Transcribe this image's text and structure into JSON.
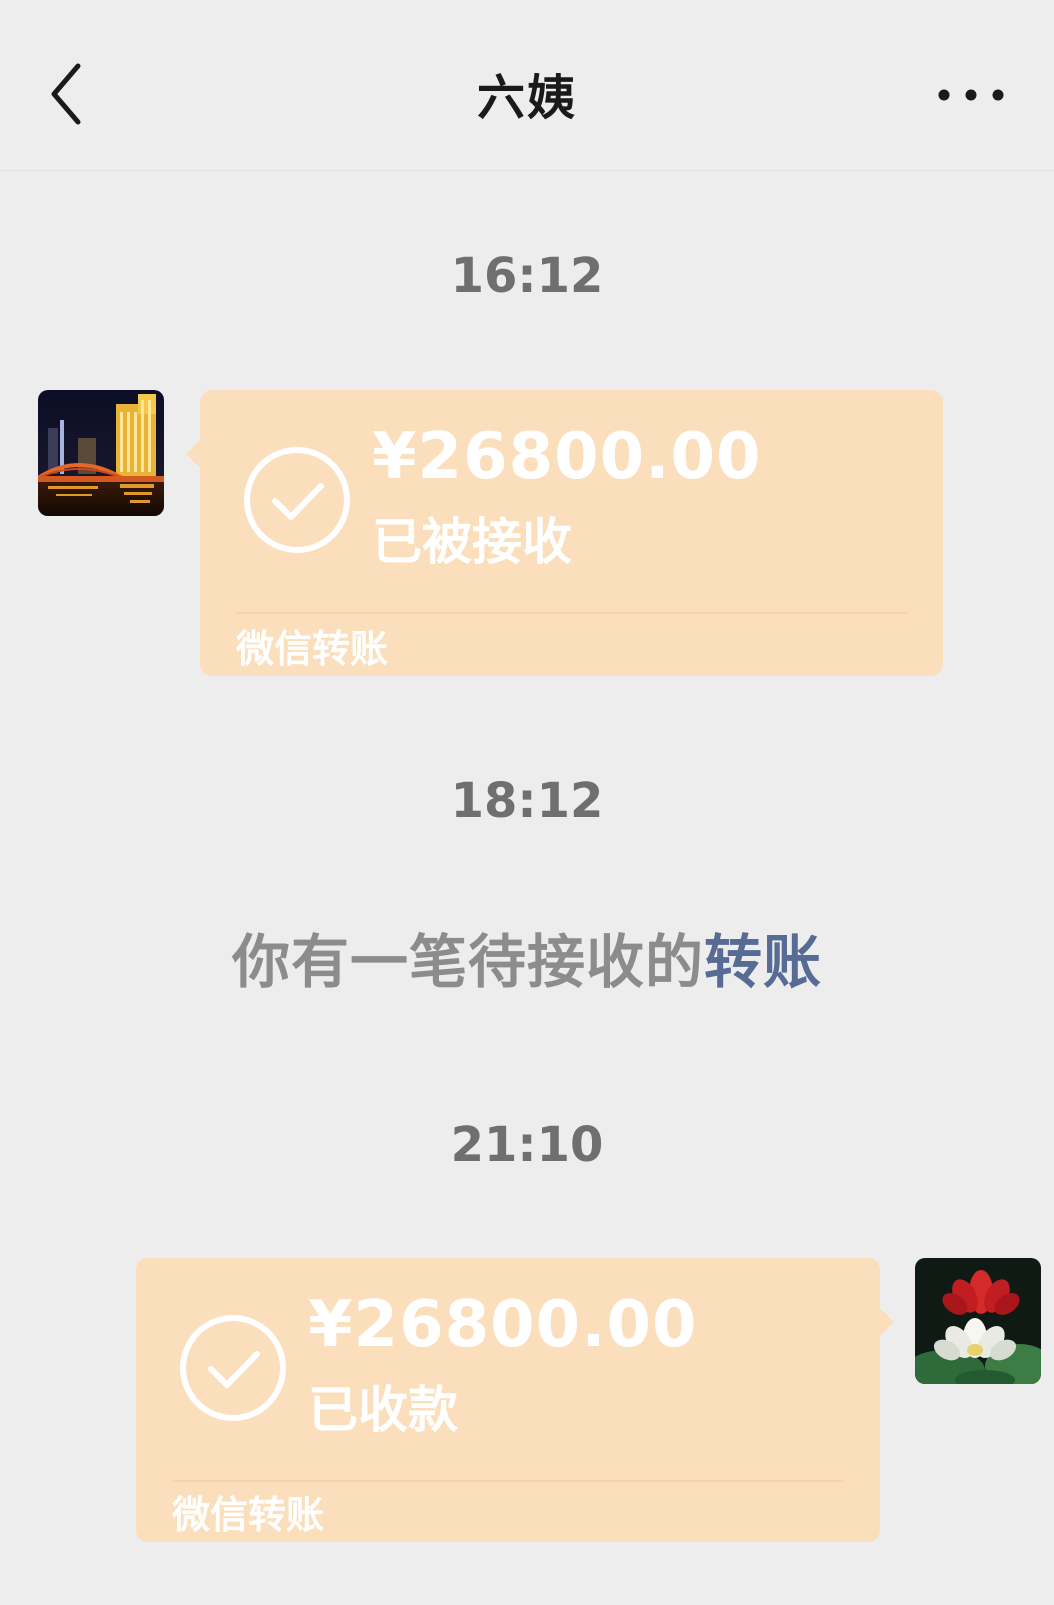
{
  "header": {
    "title": "六姨",
    "back_icon": "chevron-left-icon",
    "more_icon": "more-dots-icon"
  },
  "messages": [
    {
      "timestamp": "16:12",
      "transfer": {
        "direction": "incoming",
        "amount": "¥26800.00",
        "status": "已被接收",
        "source": "微信转账"
      }
    },
    {
      "timestamp": "18:12",
      "system": {
        "text": "你有一笔待接收的",
        "link_text": "转账"
      }
    },
    {
      "timestamp": "21:10",
      "transfer": {
        "direction": "outgoing",
        "amount": "¥26800.00",
        "status": "已收款",
        "source": "微信转账"
      }
    }
  ],
  "colors": {
    "background": "#ededed",
    "transfer_bubble": "#fbdfbd",
    "timestamp": "#6f6f6f",
    "system_text": "#8c8c8c",
    "link": "#576b95"
  }
}
